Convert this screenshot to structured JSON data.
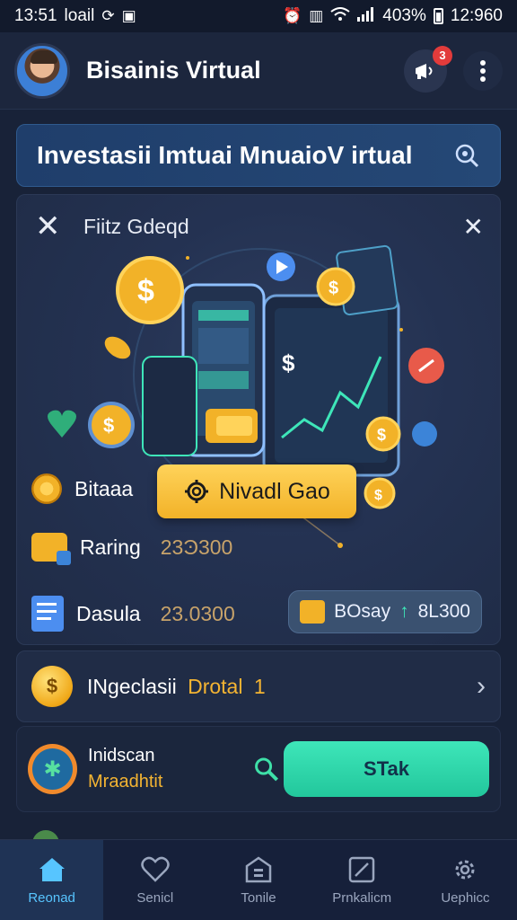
{
  "status_bar": {
    "time": "13:51",
    "carrier": "loail",
    "battery_percent": "403%",
    "clock_right": "12:960"
  },
  "header": {
    "title": "Bisainis Virtual",
    "notification_count": "3",
    "avatar_icon": "user-avatar",
    "notification_icon": "megaphone-icon",
    "more_icon": "vertical-dots-icon"
  },
  "search_banner": {
    "title": "Investasii Imtuai MnuaioV irtual",
    "icon": "search-icon"
  },
  "promo": {
    "heading": "Fiitz Gdeqd",
    "cta_label": "Nivadl Gao",
    "rows": [
      {
        "label": "Bitaaa",
        "value": ""
      },
      {
        "label": "Raring",
        "value": "23Ͽ300"
      },
      {
        "label": "Dasula",
        "value": "23.0300"
      }
    ],
    "bonus": {
      "label": "BOsay",
      "value": "8L300",
      "arrow": "↑"
    }
  },
  "invest_row": {
    "label": "INgeclasii",
    "highlight": "Drotal",
    "count": "1"
  },
  "action_row": {
    "line1": "Inidscan",
    "line2": "Mraadhtit",
    "button_label": "STak"
  },
  "bottom_nav": {
    "items": [
      {
        "label": "Reonad",
        "icon": "home-icon",
        "active": true
      },
      {
        "label": "Senicl",
        "icon": "heart-icon",
        "active": false
      },
      {
        "label": "Tonile",
        "icon": "building-icon",
        "active": false
      },
      {
        "label": "Prnkalicm",
        "icon": "edit-icon",
        "active": false
      },
      {
        "label": "Uephicc",
        "icon": "settings-icon",
        "active": false
      }
    ]
  },
  "colors": {
    "background": "#182238",
    "accent_gold": "#f4b432",
    "accent_teal": "#2fd6aa",
    "nav_active": "#57c5ff"
  }
}
